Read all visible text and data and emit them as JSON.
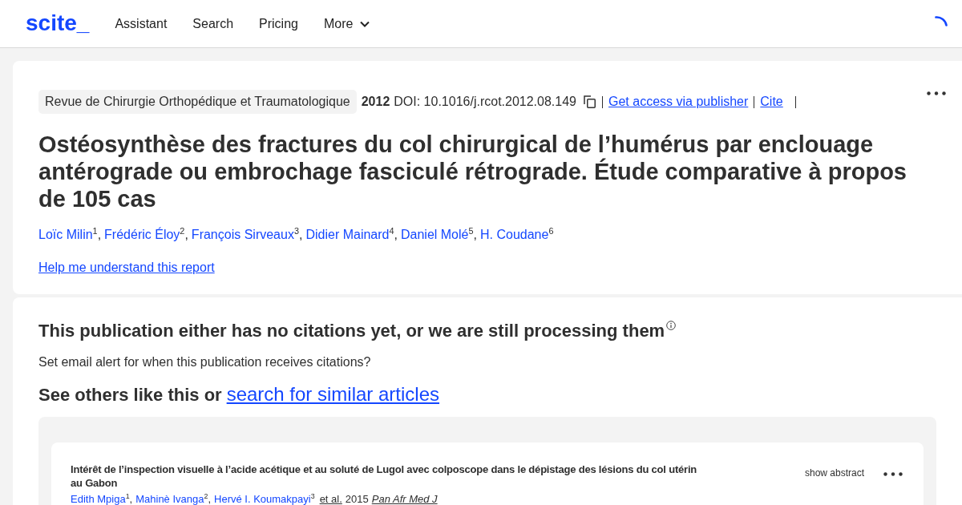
{
  "header": {
    "logo": "scite_",
    "nav": [
      {
        "label": "Assistant",
        "kind": "link"
      },
      {
        "label": "Search",
        "kind": "link"
      },
      {
        "label": "Pricing",
        "kind": "link"
      },
      {
        "label": "More",
        "kind": "dropdown"
      }
    ]
  },
  "article": {
    "journal": "Revue de Chirurgie Orthopédique et Traumatologique",
    "year": "2012",
    "doi": "DOI: 10.1016/j.rcot.2012.08.149",
    "actions": [
      "Get access via publisher",
      "Cite"
    ],
    "title": "Ostéosynthèse des fractures du col chirurgical de l’humérus par enclouage antérograde ou embrochage fasciculé rétrograde. Étude comparative à propos de 105 cas",
    "author_separator": ",",
    "authors": [
      "Loïc Milin$^{1}$",
      "Frédéric Éloy$^{2}$",
      "François Sirveaux$^{3}$",
      "Didier Mainard$^{4}$",
      "Daniel Molé$^{5}$",
      "H. Coudane$^{6}$"
    ],
    "help_link": "Help me understand this report"
  },
  "citations": {
    "heading": "This publication either has no citations yet, or we are still processing them",
    "alert_text": "Set email alert for when this publication receives citations?",
    "similar_lead": "See others like this or",
    "similar_link": "search for similar articles",
    "results": [
      {
        "title": "Intérêt de l’inspection visuelle à l’acide acétique et au soluté de Lugol avec colposcope dans le dépistage des lésions du col utérin au Gabon",
        "show_abstract": "show abstract",
        "author_separator": ",",
        "authors": [
          "Edith Mpiga$^{1}$",
          "Mahinè Ivanga$^{2}$",
          "Hervé I. Koumakpayi$^{3}$"
        ],
        "et_al": "et al.",
        "year": "2015",
        "journal": "Pan Afr Med J"
      }
    ]
  }
}
